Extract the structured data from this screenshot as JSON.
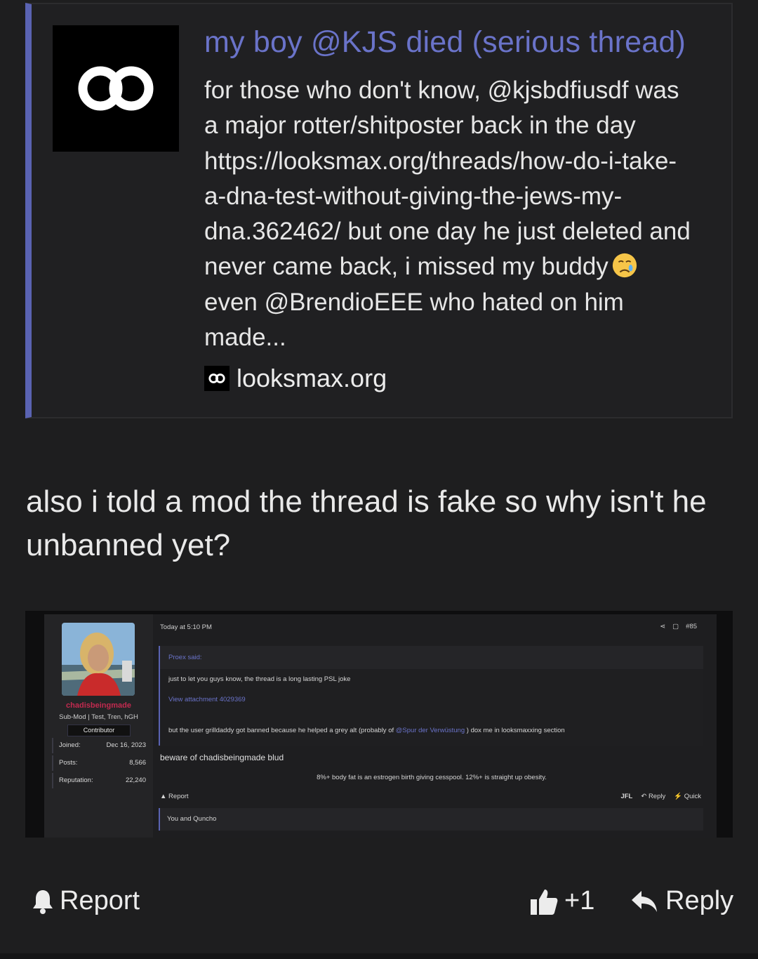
{
  "embed": {
    "title": "my boy @KJS died (serious thread)",
    "description": "for those who don't know, @kjsbdfiusdf was\na major rotter/shitposter back in the day\nhttps://looksmax.org/threads/how-do-i-take-\na-dna-test-without-giving-the-jews-my-\ndna.362462/ but one day he just deleted and\nnever came back, i missed my buddy",
    "description_cont": "even @BrendioEEE who hated on him\nmade...",
    "site": "looksmax.org",
    "accent_color": "#5a63b2"
  },
  "post": {
    "text": "also i told a mod the thread is fake so why isn't he unbanned yet?"
  },
  "screenshot": {
    "user": {
      "name": "chadisbeingmade",
      "title": "Sub-Mod | Test, Tren, hGH",
      "badge": "Contributor",
      "stats": [
        {
          "label": "Joined:",
          "value": "Dec 16, 2023"
        },
        {
          "label": "Posts:",
          "value": "8,566"
        },
        {
          "label": "Reputation:",
          "value": "22,240"
        }
      ]
    },
    "timestamp": "Today at 5:10 PM",
    "post_number": "#85",
    "quote": {
      "author": "Proex said:",
      "line1": "just to let you guys know, the thread is a long lasting PSL joke",
      "attachment": "View attachment 4029369",
      "line2_pre": "but the user grilldaddy got banned because he helped a grey alt (probably of",
      "line2_mention": "@Spur der Verwüstung",
      "line2_post": ") dox me in looksmaxxing section"
    },
    "reply": "beware of chadisbeingmade blud",
    "signature": "8%+ body fat is an estrogen birth giving cesspool. 12%+ is straight up obesity.",
    "actions": {
      "report": "Report",
      "jfl": "JFL",
      "reply": "Reply",
      "quick": "Quick"
    },
    "reactions": "You and Quncho"
  },
  "footer": {
    "report": "Report",
    "like": "+1",
    "reply": "Reply"
  }
}
